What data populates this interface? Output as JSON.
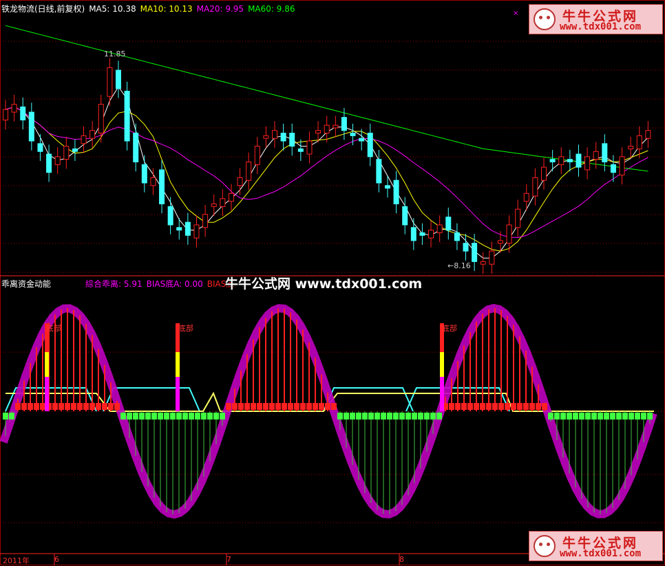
{
  "colors": {
    "up": "#ff2020",
    "down": "#40ffff",
    "ma5": "#ffffff",
    "ma10": "#ffff00",
    "ma20": "#ff00ff",
    "ma60": "#00ff00",
    "grid": "#a00000"
  },
  "main_header": {
    "title": "铁龙物流(日线,前复权)",
    "ma5": "MA5: 10.38",
    "ma10": "MA10: 10.13",
    "ma20": "MA20: 9.95",
    "ma60": "MA60: 9.86"
  },
  "annotations": {
    "high": "11.85",
    "low": "←8.16",
    "x_mark": "×"
  },
  "sub_header": {
    "title": "乖离资金动能",
    "composite": "綜合乖离: 5.91",
    "bias_a": "BIAS底A: 0.00",
    "bias_b": "BIAS底"
  },
  "bottom_labels": [
    "底部",
    "底部",
    "底部"
  ],
  "watermark": "牛牛公式网 www.tdx001.com",
  "logo": {
    "name": "牛牛公式网",
    "url": "www.tdx001.com"
  },
  "x_axis": {
    "year": "2011年",
    "m1": "6",
    "m2": "7",
    "m3": "8"
  },
  "chart_data": {
    "type": "candlestick",
    "price_range": [
      7.8,
      12.6
    ],
    "closes": [
      10.8,
      10.9,
      10.6,
      10.2,
      10.0,
      9.6,
      9.9,
      10.1,
      10.0,
      10.3,
      10.4,
      10.9,
      11.6,
      11.2,
      10.2,
      9.8,
      9.4,
      9.5,
      9.0,
      8.6,
      8.5,
      8.4,
      8.6,
      8.8,
      9.0,
      9.1,
      9.2,
      9.5,
      9.8,
      10.1,
      10.3,
      10.4,
      10.2,
      10.1,
      10.0,
      10.2,
      10.4,
      10.5,
      10.5,
      10.4,
      10.3,
      10.2,
      9.9,
      9.4,
      9.3,
      9.0,
      8.6,
      8.3,
      8.4,
      8.5,
      8.6,
      8.5,
      8.3,
      8.1,
      7.9,
      7.9,
      8.1,
      8.3,
      8.6,
      8.9,
      9.2,
      9.5,
      9.7,
      9.8,
      9.9,
      9.8,
      9.7,
      9.9,
      10.0,
      9.8,
      9.6,
      9.9,
      10.1,
      10.3,
      10.4
    ],
    "ma_notes": "MA5 white, MA10 yellow, MA20 magenta, MA60 green"
  }
}
